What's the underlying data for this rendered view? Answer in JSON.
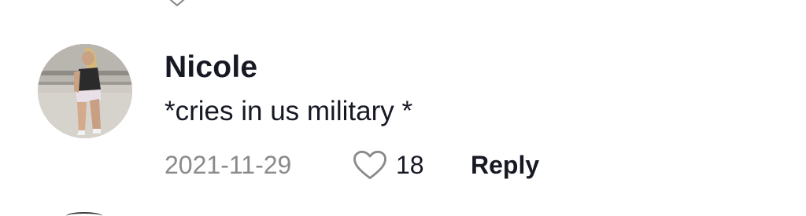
{
  "comment": {
    "username": "Nicole",
    "text": "*cries in us military *",
    "date": "2021-11-29",
    "like_count": "18",
    "reply_label": "Reply"
  },
  "icons": {
    "avatar": "profile-photo",
    "like": "heart-outline-icon"
  },
  "colors": {
    "text_primary": "#161823",
    "text_secondary": "#8a8a8a",
    "background": "#ffffff"
  }
}
